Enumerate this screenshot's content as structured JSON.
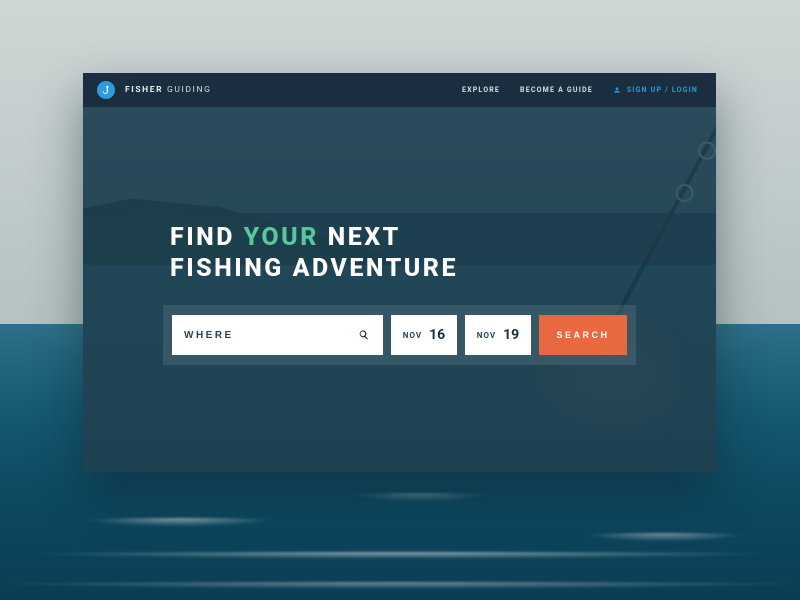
{
  "brand": {
    "primary": "FISHER",
    "secondary": "GUIDING"
  },
  "nav": {
    "explore": "EXPLORE",
    "become_guide": "BECOME A GUIDE",
    "auth": "SIGN UP / LOGIN"
  },
  "hero": {
    "line1_a": "FIND ",
    "line1_accent": "YOUR",
    "line1_b": " NEXT",
    "line2": "FISHING ADVENTURE"
  },
  "search": {
    "where_placeholder": "WHERE",
    "start": {
      "month": "NOV",
      "day": "16"
    },
    "end": {
      "month": "NOV",
      "day": "19"
    },
    "button": "SEARCH"
  },
  "colors": {
    "accent": "#58c79b",
    "cta": "#e8683f",
    "brand_blue": "#2e9bdc",
    "navy": "#1a2e3f"
  }
}
